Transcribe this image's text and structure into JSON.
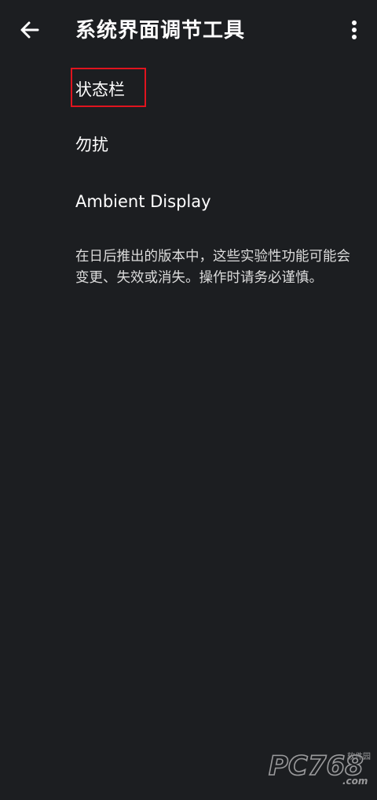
{
  "app_bar": {
    "title": "系统界面调节工具",
    "back_icon": "arrow-back-icon",
    "overflow_icon": "more-vert-icon"
  },
  "list": {
    "items": [
      {
        "label": "状态栏",
        "highlighted": true
      },
      {
        "label": "勿扰",
        "highlighted": false
      },
      {
        "label": "Ambient Display",
        "highlighted": false
      }
    ]
  },
  "footnote": "在日后推出的版本中，这些实验性功能可能会变更、失效或消失。操作时请务必谨慎。",
  "watermark": {
    "brand": "PC768",
    "sub": "软件园",
    "domain": ".com"
  },
  "colors": {
    "background": "#1c1e21",
    "text": "#ffffff",
    "secondary_text": "#dcdcdc",
    "highlight": "#e0141e"
  }
}
